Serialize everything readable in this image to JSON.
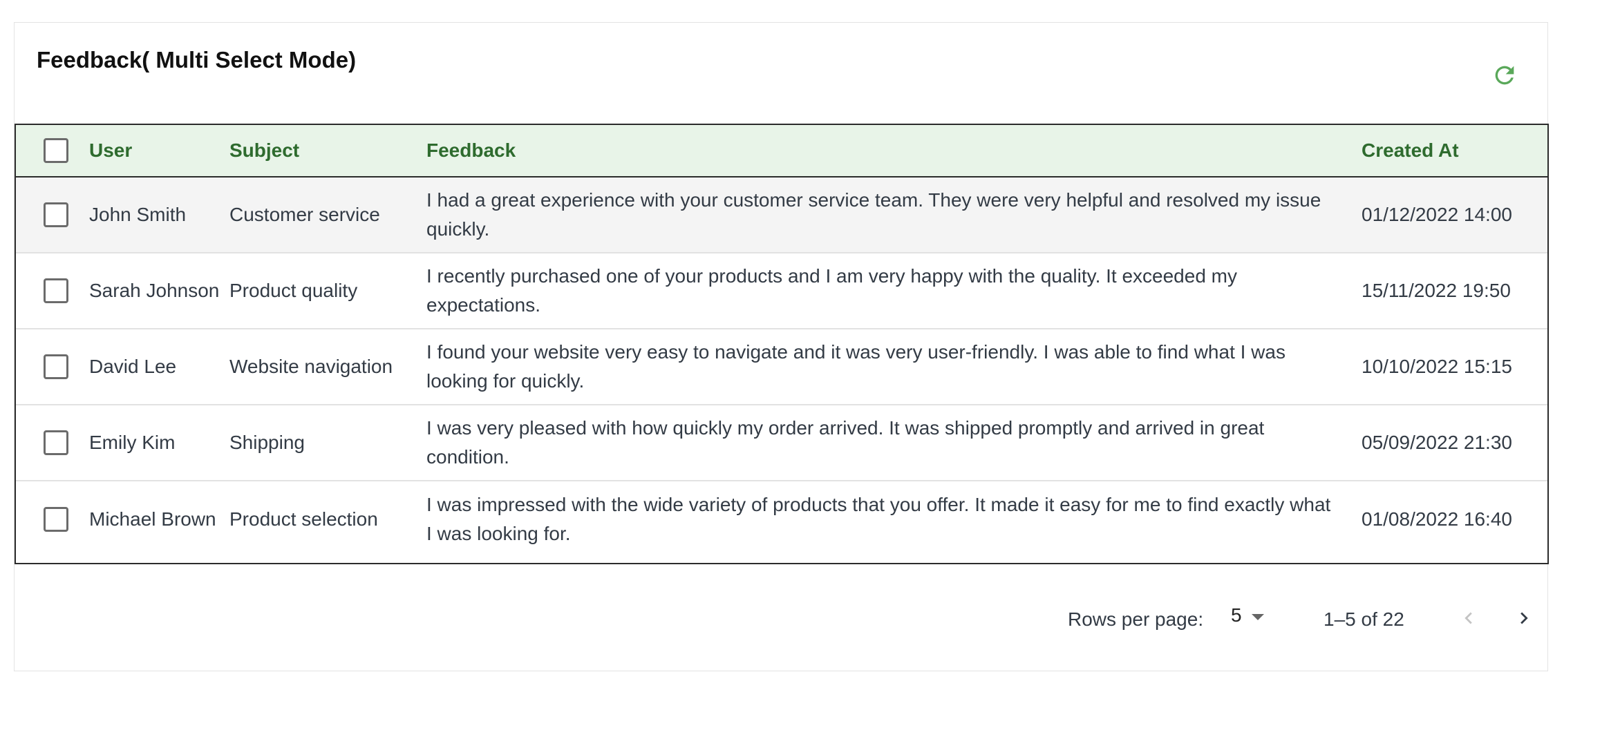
{
  "title": "Feedback( Multi Select Mode)",
  "icons": {
    "refresh": "refresh-icon",
    "prev": "chevron-left-icon",
    "next": "chevron-right-icon",
    "dropdown": "caret-down-icon"
  },
  "colors": {
    "accent": "#5aa85a",
    "header_bg": "#e8f4e8",
    "header_text": "#2e6b2e"
  },
  "table": {
    "columns": {
      "user": "User",
      "subject": "Subject",
      "feedback": "Feedback",
      "created": "Created At"
    },
    "rows": [
      {
        "user": "John Smith",
        "subject": "Customer service",
        "feedback": "I had a great experience with your customer service team. They were very helpful and resolved my issue quickly.",
        "created": "01/12/2022 14:00"
      },
      {
        "user": "Sarah Johnson",
        "subject": "Product quality",
        "feedback": "I recently purchased one of your products and I am very happy with the quality. It exceeded my expectations.",
        "created": "15/11/2022 19:50"
      },
      {
        "user": "David Lee",
        "subject": "Website navigation",
        "feedback": "I found your website very easy to navigate and it was very user-friendly. I was able to find what I was looking for quickly.",
        "created": "10/10/2022 15:15"
      },
      {
        "user": "Emily Kim",
        "subject": "Shipping",
        "feedback": "I was very pleased with how quickly my order arrived. It was shipped promptly and arrived in great condition.",
        "created": "05/09/2022 21:30"
      },
      {
        "user": "Michael Brown",
        "subject": "Product selection",
        "feedback": "I was impressed with the wide variety of products that you offer. It made it easy for me to find exactly what I was looking for.",
        "created": "01/08/2022 16:40"
      }
    ]
  },
  "pagination": {
    "rows_per_page_label": "Rows per page:",
    "rows_per_page_value": "5",
    "range": "1–5 of 22"
  }
}
